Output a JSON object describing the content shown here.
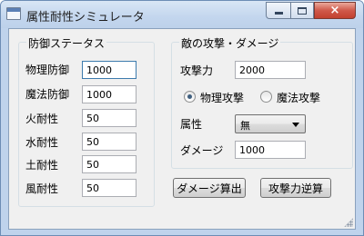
{
  "window": {
    "title": "属性耐性シミュレータ"
  },
  "title_controls": {
    "minimize": "minimize-icon",
    "maximize": "maximize-icon",
    "close": "×"
  },
  "defense_group": {
    "title": "防御ステータス",
    "fields": [
      {
        "label": "物理防御",
        "value": "1000"
      },
      {
        "label": "魔法防御",
        "value": "1000"
      },
      {
        "label": "火耐性",
        "value": "50"
      },
      {
        "label": "水耐性",
        "value": "50"
      },
      {
        "label": "土耐性",
        "value": "50"
      },
      {
        "label": "風耐性",
        "value": "50"
      }
    ]
  },
  "attack_group": {
    "title": "敵の攻撃・ダメージ",
    "attack_label": "攻撃力",
    "attack_value": "2000",
    "radio_physical": "物理攻撃",
    "radio_magic": "魔法攻撃",
    "selected_attack_type": "物理攻撃",
    "element_label": "属性",
    "element_value": "無",
    "damage_label": "ダメージ",
    "damage_value": "1000"
  },
  "buttons": {
    "calc_damage": "ダメージ算出",
    "reverse_attack": "攻撃力逆算"
  },
  "colors": {
    "accent_focus": "#3d7bad",
    "close_button": "#c2402f",
    "window_frame": "#bfd3ec"
  }
}
